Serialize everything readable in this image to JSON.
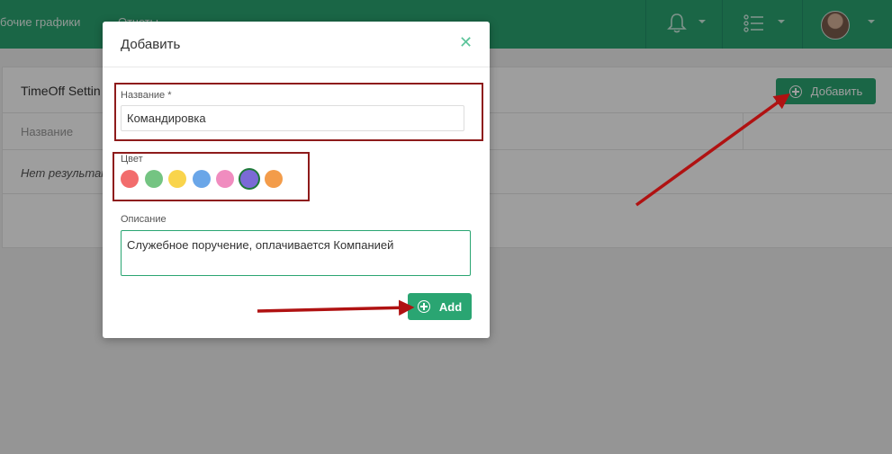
{
  "topbar": {
    "nav_schedules": "бочие графики",
    "nav_reports": "Отчеты",
    "bell_icon": "bell-icon",
    "list_icon": "list-icon",
    "avatar": "user-avatar",
    "bg_color": "#2aa572"
  },
  "panel": {
    "title": "TimeOff Settin",
    "column_name": "Название",
    "no_results": "Нет результато",
    "add_button_label": "Добавить"
  },
  "modal": {
    "title": "Добавить",
    "close_icon": "close-icon",
    "name_label": "Название *",
    "name_value": "Командировка",
    "color_label": "Цвет",
    "colors": [
      "#f26c6c",
      "#74c482",
      "#f9d44c",
      "#6aa6e8",
      "#f08cbf",
      "#7b6ad6",
      "#f39c4a"
    ],
    "selected_color_index": 5,
    "description_label": "Описание",
    "description_value": "Служебное поручение, оплачивается Компанией",
    "add_button_label": "Add"
  },
  "accent_color": "#2aa572",
  "annotation_color": "#b01212"
}
